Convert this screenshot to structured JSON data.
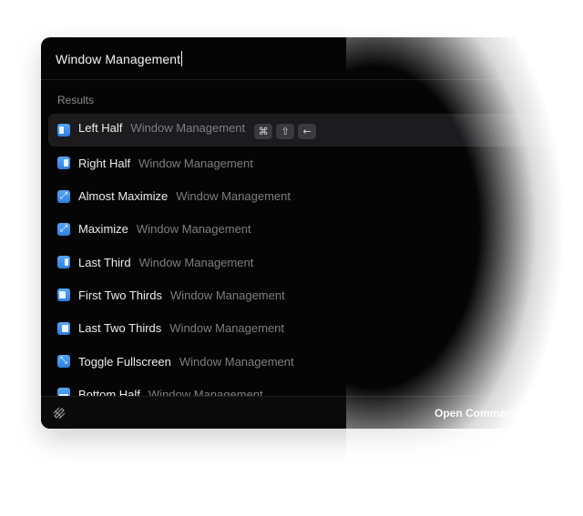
{
  "search": {
    "query": "Window Management"
  },
  "results": {
    "section_title": "Results",
    "items": [
      {
        "title": "Left Half",
        "subtitle": "Window Management",
        "icon": "left-half-icon",
        "selected": true
      },
      {
        "title": "Right Half",
        "subtitle": "Window Management",
        "icon": "right-half-icon"
      },
      {
        "title": "Almost Maximize",
        "subtitle": "Window Management",
        "icon": "almost-maximize-icon"
      },
      {
        "title": "Maximize",
        "subtitle": "Window Management",
        "icon": "maximize-icon"
      },
      {
        "title": "Last Third",
        "subtitle": "Window Management",
        "icon": "last-third-icon"
      },
      {
        "title": "First Two Thirds",
        "subtitle": "Window Management",
        "icon": "first-two-thirds-icon"
      },
      {
        "title": "Last Two Thirds",
        "subtitle": "Window Management",
        "icon": "last-two-thirds-icon"
      },
      {
        "title": "Toggle Fullscreen",
        "subtitle": "Window Management",
        "icon": "toggle-fullscreen-icon"
      },
      {
        "title": "Bottom Half",
        "subtitle": "Window Management",
        "icon": "bottom-half-icon"
      }
    ],
    "shortcut": {
      "keys": [
        "⌘",
        "⇧",
        "←"
      ],
      "key_names": [
        "command-key",
        "shift-key",
        "left-arrow-key"
      ]
    }
  },
  "footer": {
    "action_label": "Open Command",
    "logo_icon": "raycast-logo-icon"
  },
  "colors": {
    "window_bg": "#050505",
    "selected_row": "#1c1c1e",
    "icon_blue": "#3b8ae8",
    "text_primary": "#ececec",
    "text_secondary": "#7e7e83"
  }
}
